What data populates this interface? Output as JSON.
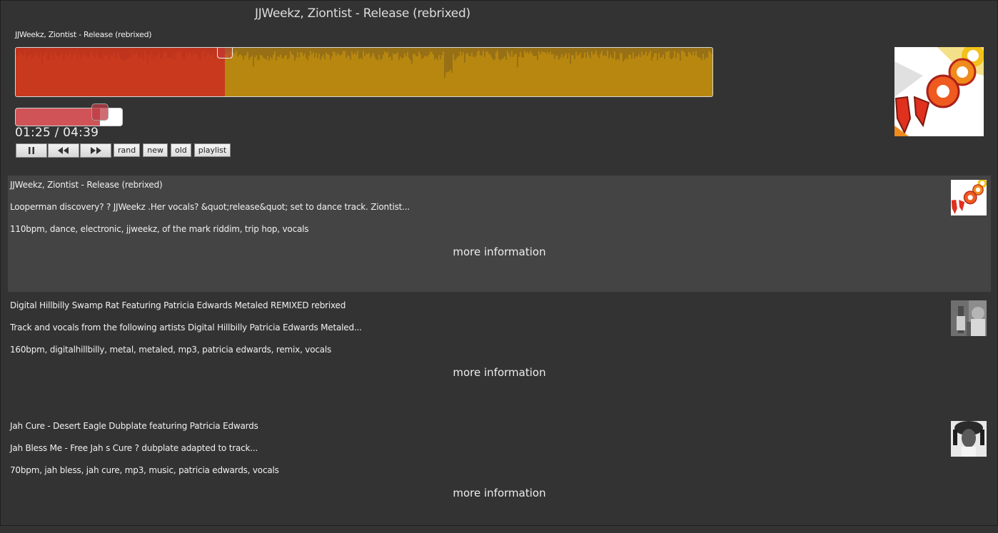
{
  "player": {
    "title": "JJWeekz, Ziontist - Release (rebrixed)",
    "waveform_title": "JJWeekz, Ziontist - Release (rebrixed)",
    "progress": 0.3,
    "volume": 0.79,
    "time": "01:25 / 04:39",
    "controls": {
      "pause_icon": "pause-icon",
      "rewind_icon": "rewind-icon",
      "forward_icon": "fast-forward-icon"
    },
    "buttons": {
      "rand": "rand",
      "new": "new",
      "old": "old",
      "playlist": "playlist"
    },
    "colors": {
      "played": "#c8391d",
      "unplayed": "#b8870f",
      "volume": "#d05357",
      "background": "#333333",
      "active_row": "#444444"
    }
  },
  "tracks": [
    {
      "title": "JJWeekz, Ziontist - Release (rebrixed)",
      "description": "Looperman discovery? ? JJWeekz .Her vocals? &quot;release&quot; set to dance track. Ziontist...",
      "tags": "110bpm, dance, electronic, jjweekz, of the mark riddim, trip hop, vocals",
      "more": "more information"
    },
    {
      "title": "Digital Hillbilly Swamp Rat Featuring Patricia Edwards Metaled REMIXED rebrixed",
      "description": "Track and vocals from the following artists Digital Hillbilly Patricia Edwards Metaled...",
      "tags": "160bpm, digitalhillbilly, metal, metaled, mp3, patricia edwards, remix, vocals",
      "more": "more information"
    },
    {
      "title": "Jah Cure - Desert Eagle Dubplate featuring Patricia Edwards",
      "description": "Jah Bless Me - Free Jah s Cure ? dubplate adapted to track...",
      "tags": "70bpm, jah bless, jah cure, mp3, music, patricia edwards, vocals",
      "more": "more information"
    }
  ]
}
